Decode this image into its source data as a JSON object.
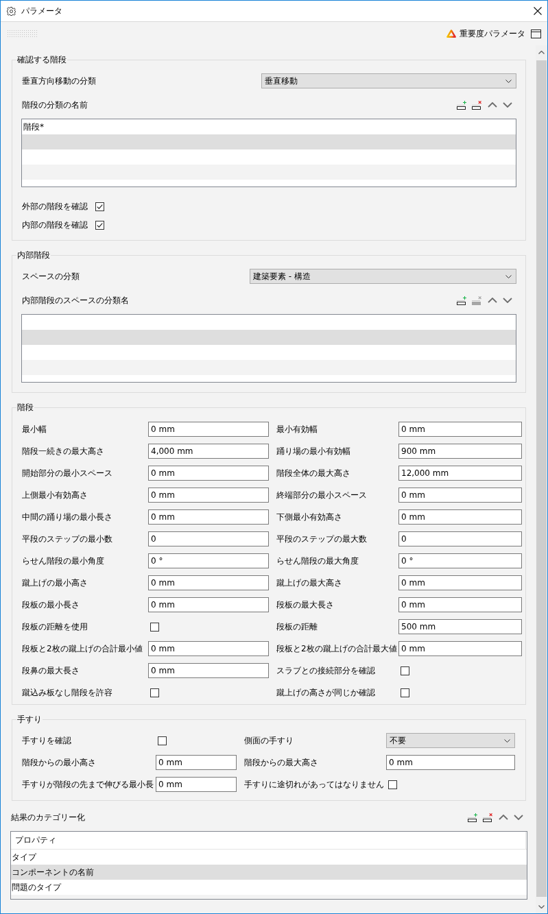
{
  "window": {
    "title": "パラメータ"
  },
  "toolbar": {
    "severity_button": "重要度パラメータ"
  },
  "stairs_to_check": {
    "title": "確認する階段",
    "classification": {
      "label": "垂直方向移動の分類",
      "value": "垂直移動"
    },
    "names": {
      "label": "階段の分類の名前",
      "tools": [
        {
          "kind": "add",
          "disabled": false
        },
        {
          "kind": "remove",
          "disabled": false
        },
        {
          "kind": "up",
          "disabled": false
        },
        {
          "kind": "down",
          "disabled": false
        }
      ],
      "rows": [
        "階段*"
      ]
    },
    "checks": [
      {
        "label": "外部の階段を確認",
        "checked": true
      },
      {
        "label": "内部の階段を確認",
        "checked": true
      }
    ]
  },
  "interior_stairs": {
    "title": "内部階段",
    "classification": {
      "label": "スペースの分類",
      "value": "建築要素 - 構造"
    },
    "names": {
      "label": "内部階段のスペースの分類名",
      "tools": [
        {
          "kind": "add",
          "disabled": false
        },
        {
          "kind": "remove",
          "disabled": true
        },
        {
          "kind": "up",
          "disabled": false
        },
        {
          "kind": "down",
          "disabled": false
        }
      ]
    }
  },
  "stairs": {
    "title": "階段",
    "fields": [
      {
        "kind": "text",
        "label": "最小幅",
        "value": "0 mm"
      },
      {
        "kind": "text",
        "label": "最小有効幅",
        "value": "0 mm"
      },
      {
        "kind": "text",
        "label": "階段一続きの最大高さ",
        "value": "4,000 mm"
      },
      {
        "kind": "text",
        "label": "踊り場の最小有効幅",
        "value": "900 mm"
      },
      {
        "kind": "text",
        "label": "開始部分の最小スペース",
        "value": "0 mm"
      },
      {
        "kind": "text",
        "label": "階段全体の最大高さ",
        "value": "12,000 mm"
      },
      {
        "kind": "text",
        "label": "上側最小有効高さ",
        "value": "0 mm"
      },
      {
        "kind": "text",
        "label": "終端部分の最小スペース",
        "value": "0 mm"
      },
      {
        "kind": "text",
        "label": "中間の踊り場の最小長さ",
        "value": "0 mm"
      },
      {
        "kind": "text",
        "label": "下側最小有効高さ",
        "value": "0 mm"
      },
      {
        "kind": "text",
        "label": "平段のステップの最小数",
        "value": "0"
      },
      {
        "kind": "text",
        "label": "平段のステップの最大数",
        "value": "0"
      },
      {
        "kind": "text",
        "label": "らせん階段の最小角度",
        "value": "0 °"
      },
      {
        "kind": "text",
        "label": "らせん階段の最大角度",
        "value": "0 °"
      },
      {
        "kind": "text",
        "label": "蹴上げの最小高さ",
        "value": "0 mm"
      },
      {
        "kind": "text",
        "label": "蹴上げの最大高さ",
        "value": "0 mm"
      },
      {
        "kind": "text",
        "label": "段板の最小長さ",
        "value": "0 mm"
      },
      {
        "kind": "text",
        "label": "段板の最大長さ",
        "value": "0 mm"
      },
      {
        "kind": "checkbox",
        "label": "段板の距離を使用",
        "checked": false
      },
      {
        "kind": "text",
        "label": "段板の距離",
        "value": "500 mm"
      },
      {
        "kind": "text",
        "label": "段板と2枚の蹴上げの合計最小値",
        "value": "0 mm"
      },
      {
        "kind": "text",
        "label": "段板と2枚の蹴上げの合計最大値",
        "value": "0 mm"
      },
      {
        "kind": "text",
        "label": "段鼻の最大長さ",
        "value": "0 mm"
      },
      {
        "kind": "checkbox",
        "label": "スラブとの接続部分を確認",
        "checked": false
      },
      {
        "kind": "checkbox",
        "label": "蹴込み板なし階段を許容",
        "checked": false
      },
      {
        "kind": "checkbox",
        "label": "蹴上げの高さが同じか確認",
        "checked": false
      }
    ]
  },
  "handrails": {
    "title": "手すり",
    "fields": [
      {
        "kind": "checkbox",
        "label": "手すりを確認",
        "checked": false
      },
      {
        "kind": "dropdown",
        "label": "側面の手すり",
        "value": "不要"
      },
      {
        "kind": "text",
        "label": "階段からの最小高さ",
        "value": "0 mm"
      },
      {
        "kind": "text",
        "label": "階段からの最大高さ",
        "value": "0 mm"
      },
      {
        "kind": "text",
        "label": "手すりが階段の先まで伸びる最小長",
        "value": "0 mm"
      },
      {
        "kind": "checkbox",
        "label": "手すりに途切れがあってはなりません",
        "checked": false
      }
    ]
  },
  "result_categorization": {
    "title": "結果のカテゴリー化",
    "tools": [
      {
        "kind": "add",
        "disabled": false
      },
      {
        "kind": "remove",
        "disabled": false
      },
      {
        "kind": "up",
        "disabled": false
      },
      {
        "kind": "down",
        "disabled": false
      }
    ],
    "columns": [
      "プロパティ"
    ],
    "rows": [
      "タイプ",
      "コンポーネントの名前",
      "問題のタイプ"
    ]
  }
}
